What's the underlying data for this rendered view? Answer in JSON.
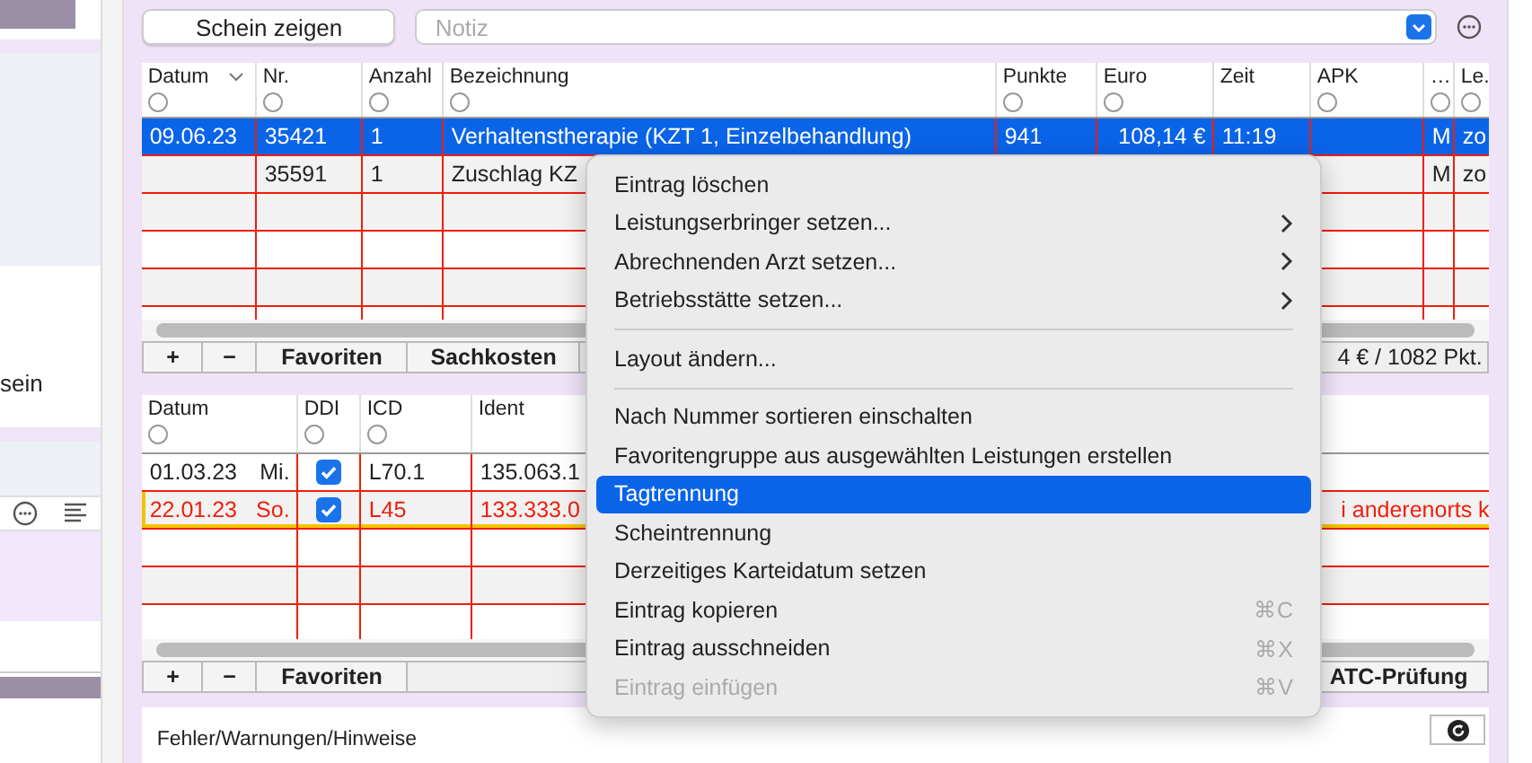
{
  "sidebar": {
    "text": "sein"
  },
  "toolbar": {
    "button": "Schein zeigen",
    "note": {
      "placeholder": "Notiz"
    }
  },
  "services_table": {
    "columns": [
      {
        "label": "Datum",
        "sorted": true,
        "filter": true
      },
      {
        "label": "Nr.",
        "sorted": false,
        "filter": true
      },
      {
        "label": "Anzahl",
        "sorted": false,
        "filter": true
      },
      {
        "label": "Bezeichnung",
        "sorted": false,
        "filter": true
      },
      {
        "label": "Punkte",
        "sorted": false,
        "filter": true
      },
      {
        "label": "Euro",
        "sorted": false,
        "filter": true
      },
      {
        "label": "Zeit",
        "sorted": false,
        "filter": false
      },
      {
        "label": "APK",
        "sorted": false,
        "filter": true
      },
      {
        "label": "…",
        "sorted": false,
        "filter": true
      },
      {
        "label": "Le.",
        "sorted": false,
        "filter": true
      }
    ],
    "rows": [
      {
        "selected": true,
        "cells": [
          "09.06.23",
          "35421",
          "1",
          "Verhaltenstherapie (KZT 1, Einzelbehandlung)",
          "941",
          "108,14 €",
          "11:19",
          null,
          "M",
          "zo"
        ]
      },
      {
        "selected": false,
        "cells": [
          null,
          "35591",
          "1",
          "Zuschlag KZ",
          null,
          null,
          null,
          null,
          "M",
          "zo"
        ]
      }
    ]
  },
  "services_footer": {
    "buttons": [
      "+",
      "−",
      "Favoriten",
      "Sachkosten"
    ],
    "summary": "4 € / 1082 Pkt."
  },
  "diagnoses_table": {
    "columns": [
      {
        "label": "Datum",
        "filter": true
      },
      {
        "label": "DDI",
        "filter": true
      },
      {
        "label": "ICD",
        "filter": true
      },
      {
        "label": "Ident",
        "filter": false
      }
    ],
    "rows": [
      {
        "date": "01.03.23",
        "weekday": "Mi.",
        "ddi": true,
        "icd": "L70.1",
        "ident": "135.063.1",
        "error": false,
        "focused": false
      },
      {
        "date": "22.01.23",
        "weekday": "So.",
        "ddi": true,
        "icd": "L45",
        "ident": "133.333.0",
        "remark": "i anderenorts k",
        "error": true,
        "focused": true
      }
    ]
  },
  "diagnoses_footer": {
    "buttons": [
      "+",
      "−",
      "Favoriten"
    ],
    "check_button": "ATC-Prüfung"
  },
  "messages": {
    "title": "Fehler/Warnungen/Hinweise"
  },
  "context_menu": {
    "items": [
      {
        "kind": "item",
        "label": "Eintrag löschen",
        "submenu": false,
        "disabled": false,
        "selected": false
      },
      {
        "kind": "item",
        "label": "Leistungserbringer setzen...",
        "submenu": true,
        "disabled": false,
        "selected": false
      },
      {
        "kind": "item",
        "label": "Abrechnenden Arzt setzen...",
        "submenu": true,
        "disabled": false,
        "selected": false
      },
      {
        "kind": "item",
        "label": "Betriebsstätte setzen...",
        "submenu": true,
        "disabled": false,
        "selected": false
      },
      {
        "kind": "separator"
      },
      {
        "kind": "item",
        "label": "Layout ändern...",
        "submenu": false,
        "disabled": false,
        "selected": false
      },
      {
        "kind": "separator"
      },
      {
        "kind": "item",
        "label": "Nach Nummer sortieren einschalten",
        "submenu": false,
        "disabled": false,
        "selected": false
      },
      {
        "kind": "item",
        "label": "Favoritengruppe aus ausgewählten Leistungen erstellen",
        "submenu": false,
        "disabled": false,
        "selected": false
      },
      {
        "kind": "item",
        "label": "Tagtrennung",
        "submenu": false,
        "disabled": false,
        "selected": true
      },
      {
        "kind": "item",
        "label": "Scheintrennung",
        "submenu": false,
        "disabled": false,
        "selected": false
      },
      {
        "kind": "item",
        "label": "Derzeitiges Karteidatum setzen",
        "submenu": false,
        "disabled": false,
        "selected": false
      },
      {
        "kind": "item",
        "label": "Eintrag kopieren",
        "shortcut": "⌘C",
        "submenu": false,
        "disabled": false,
        "selected": false
      },
      {
        "kind": "item",
        "label": "Eintrag ausschneiden",
        "shortcut": "⌘X",
        "submenu": false,
        "disabled": false,
        "selected": false
      },
      {
        "kind": "item",
        "label": "Eintrag einfügen",
        "shortcut": "⌘V",
        "submenu": false,
        "disabled": true,
        "selected": false
      }
    ]
  }
}
